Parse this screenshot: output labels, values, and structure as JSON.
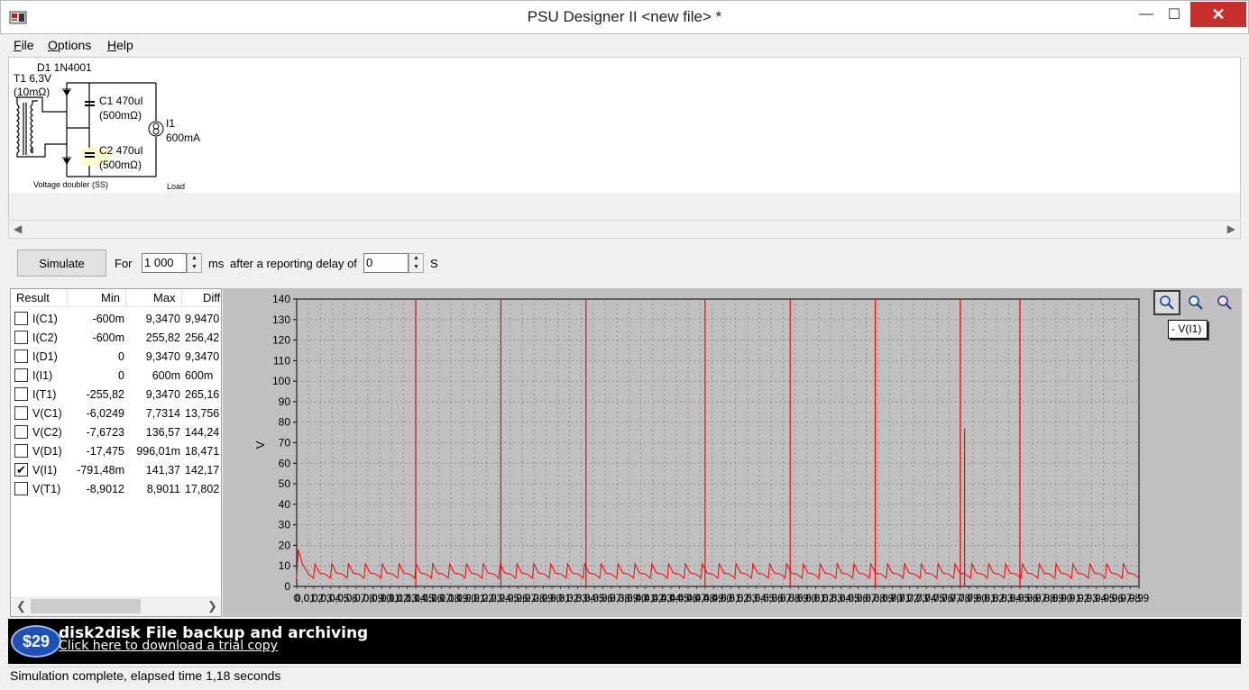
{
  "window": {
    "title": "PSU Designer II  <new file> *",
    "minimize_label": "—",
    "maximize_label": "☐",
    "close_label": "✕"
  },
  "menu": {
    "items": [
      {
        "accel": "F",
        "rest": "ile"
      },
      {
        "accel": "O",
        "rest": "ptions"
      },
      {
        "accel": "H",
        "rest": "elp"
      }
    ]
  },
  "schematic": {
    "diode_label": "D1 1N4001",
    "transformer_label": "T1 6,3V",
    "transformer_res": "(10mΩ)",
    "c1_label": "C1 470uI",
    "c1_res": "(500mΩ)",
    "c2_label": "C2 470uI",
    "c2_res": "(500mΩ)",
    "load_name": "I1",
    "load_value": "600mA",
    "topology_caption": "Voltage doubler (SS)",
    "load_caption": "Load"
  },
  "simulate": {
    "button_label": "Simulate",
    "for_label": "For",
    "duration_value": "1 000",
    "ms_label": "ms",
    "delay_label": "after a reporting delay of",
    "delay_value": "0",
    "seconds_label": "S"
  },
  "results": {
    "headers": {
      "result": "Result",
      "min": "Min",
      "max": "Max",
      "diff": "Diff"
    },
    "rows": [
      {
        "name": "I(C1)",
        "min": "-600m",
        "max": "9,3470",
        "diff": "9,9470",
        "checked": false
      },
      {
        "name": "I(C2)",
        "min": "-600m",
        "max": "255,82",
        "diff": "256,42",
        "checked": false
      },
      {
        "name": "I(D1)",
        "min": "0",
        "max": "9,3470",
        "diff": "9,3470",
        "checked": false
      },
      {
        "name": "I(I1)",
        "min": "0",
        "max": "600m",
        "diff": "600m",
        "checked": false
      },
      {
        "name": "I(T1)",
        "min": "-255,82",
        "max": "9,3470",
        "diff": "265,16",
        "checked": false
      },
      {
        "name": "V(C1)",
        "min": "-6,0249",
        "max": "7,7314",
        "diff": "13,756",
        "checked": false
      },
      {
        "name": "V(C2)",
        "min": "-7,6723",
        "max": "136,57",
        "diff": "144,24",
        "checked": false
      },
      {
        "name": "V(D1)",
        "min": "-17,475",
        "max": "996,01m",
        "diff": "18,471",
        "checked": false
      },
      {
        "name": "V(I1)",
        "min": "-791,48m",
        "max": "141,37",
        "diff": "142,17",
        "checked": true
      },
      {
        "name": "V(T1)",
        "min": "-8,9012",
        "max": "8,9011",
        "diff": "17,802",
        "checked": false
      }
    ],
    "check_mark": "✔"
  },
  "chart_data": {
    "type": "line",
    "ylabel": "V",
    "ylim": [
      0,
      140
    ],
    "yticks": [
      0,
      10,
      20,
      30,
      40,
      50,
      60,
      70,
      80,
      90,
      100,
      110,
      120,
      130,
      140
    ],
    "xlim": [
      0,
      0.99
    ],
    "grid": true,
    "series": [
      {
        "name": "V(I1)",
        "color": "#ff0000",
        "baseline_peak_first": 18,
        "baseline_peak": 11,
        "baseline_trough": 4,
        "cycles": 50,
        "spikes": [
          {
            "x": 0.14,
            "y": 141
          },
          {
            "x": 0.24,
            "y": 141
          },
          {
            "x": 0.34,
            "y": 141
          },
          {
            "x": 0.48,
            "y": 141
          },
          {
            "x": 0.58,
            "y": 141
          },
          {
            "x": 0.68,
            "y": 141
          },
          {
            "x": 0.78,
            "y": 141
          },
          {
            "x": 0.785,
            "y": 77
          },
          {
            "x": 0.85,
            "y": 141
          }
        ]
      }
    ],
    "legend": {
      "text": "- V(I1)",
      "placement": "top-right"
    }
  },
  "banner": {
    "price": "$29",
    "title": "disk2disk File backup and archiving",
    "link": "Click here to download a trial copy"
  },
  "status": {
    "text": "Simulation complete, elapsed time 1,18 seconds"
  },
  "icons": {
    "zoom_in": "magnifier-icon",
    "zoom_reset": "magnifier-icon",
    "zoom_out": "magnifier-icon"
  }
}
